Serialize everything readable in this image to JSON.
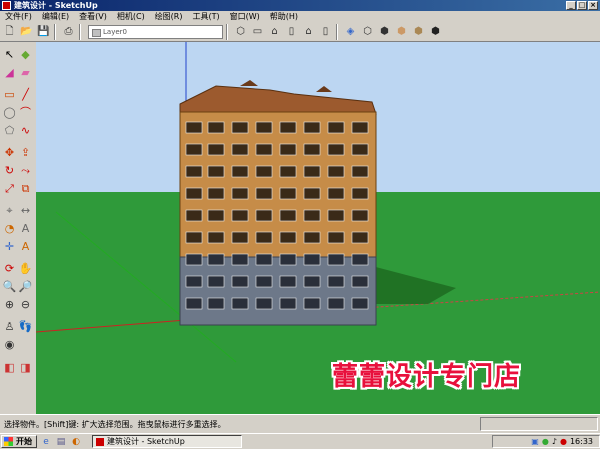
{
  "window": {
    "title": "建筑设计 - SketchUp",
    "buttons": {
      "minimize": "_",
      "maximize": "□",
      "close": "×"
    }
  },
  "menu": [
    "文件(F)",
    "编辑(E)",
    "查看(V)",
    "相机(C)",
    "绘图(R)",
    "工具(T)",
    "窗口(W)",
    "帮助(H)"
  ],
  "toolbar": {
    "layer_value": "Layer0",
    "icons": [
      "new-file-icon",
      "open-file-icon",
      "save-icon",
      "print-icon",
      "layer-icon",
      "iso-view-icon",
      "top-view-icon",
      "front-view-icon",
      "right-view-icon",
      "back-view-icon",
      "left-view-icon",
      "xray-icon",
      "wireframe-icon",
      "hidden-line-icon",
      "shaded-icon",
      "shaded-texture-icon",
      "monochrome-icon"
    ]
  },
  "scene": {
    "sky_color": "#bcd6f2",
    "ground_color": "#2f9a3a",
    "roof_color": "#a05a2c",
    "wall_color": "#c8904a",
    "base_color": "#6f7a8c"
  },
  "watermark": "蕾蕾设计专门店",
  "status": {
    "text": "选择物件。[Shift]键: 扩大选择范围。拖曳鼠标进行多重选择。"
  },
  "taskbar": {
    "start": "开始",
    "task": "建筑设计 - SketchUp",
    "clock": "16:33"
  }
}
